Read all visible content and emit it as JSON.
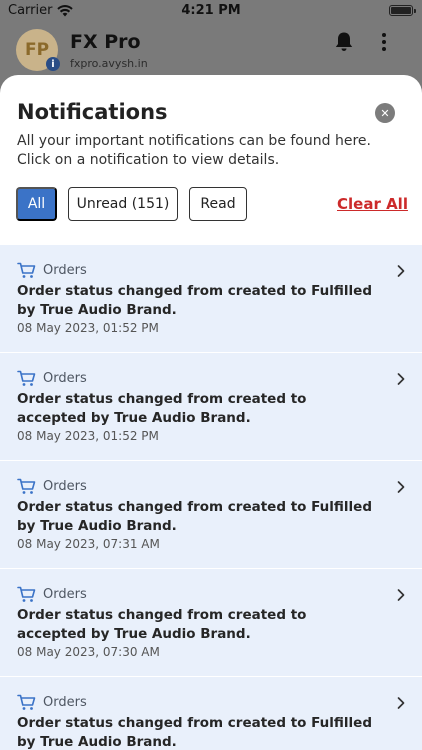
{
  "status_bar": {
    "carrier": "Carrier",
    "time": "4:21 PM",
    "battery_level": 1.0
  },
  "app_header": {
    "avatar_initials": "FP",
    "badge_glyph": "i",
    "title": "FX Pro",
    "domain": "fxpro.avysh.in",
    "icons": [
      "bell-icon",
      "kebab-menu-icon"
    ]
  },
  "sheet": {
    "title": "Notifications",
    "close_glyph": "✕",
    "subtitle": "All your important notifications can be found here. Click on a notification to view details.",
    "filters": {
      "all": "All",
      "unread": "Unread (151)",
      "read": "Read"
    },
    "active_filter": "all",
    "clear_all": "Clear All"
  },
  "notifications": [
    {
      "category": "Orders",
      "title": "Order status changed from created to Fulfilled by True Audio Brand.",
      "time": "08 May 2023, 01:52 PM"
    },
    {
      "category": "Orders",
      "title": "Order status changed from created to accepted by True Audio Brand.",
      "time": "08 May 2023, 01:52 PM"
    },
    {
      "category": "Orders",
      "title": "Order status changed from created to Fulfilled by True Audio Brand.",
      "time": "08 May 2023, 07:31 AM"
    },
    {
      "category": "Orders",
      "title": "Order status changed from created to accepted by True Audio Brand.",
      "time": "08 May 2023, 07:30 AM"
    },
    {
      "category": "Orders",
      "title": "Order status changed from created to Fulfilled by True Audio Brand.",
      "time": ""
    }
  ],
  "colors": {
    "accent": "#3b73c7",
    "danger": "#cc2a2a",
    "item_bg": "#e9f0fb",
    "overlay": "#7a7a7a"
  }
}
